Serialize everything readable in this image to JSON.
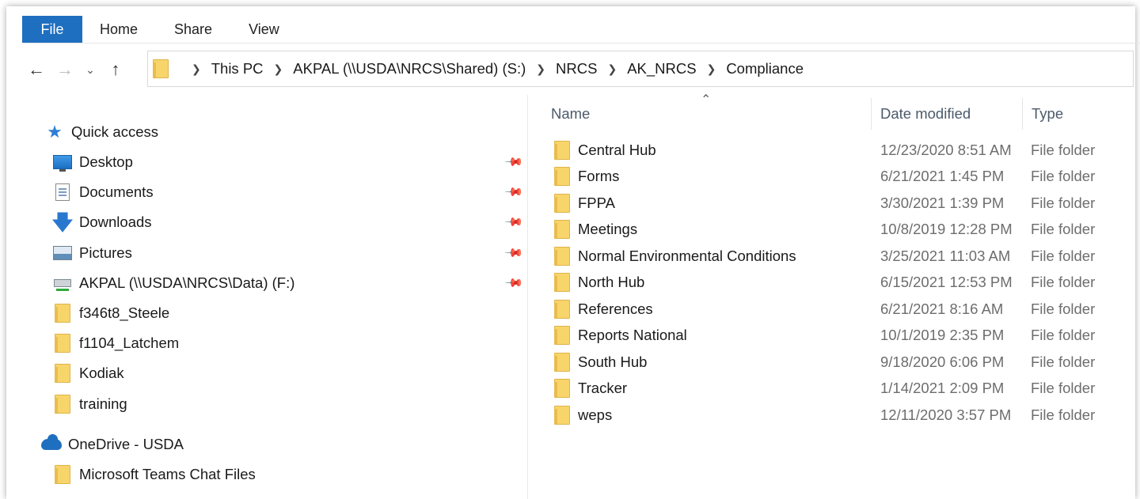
{
  "ribbon": {
    "tabs": [
      "File",
      "Home",
      "Share",
      "View"
    ]
  },
  "nav": {
    "back_icon": "arrow-left-icon",
    "forward_icon": "arrow-right-icon",
    "recent_icon": "chevron-down-icon",
    "up_icon": "arrow-up-icon"
  },
  "address": {
    "crumbs": [
      "This PC",
      "AKPAL (\\\\USDA\\NRCS\\Shared) (S:)",
      "NRCS",
      "AK_NRCS",
      "Compliance"
    ]
  },
  "sidebar": {
    "quick_access": "Quick access",
    "items": [
      {
        "label": "Desktop",
        "icon": "desktop-icon",
        "pinned": true
      },
      {
        "label": "Documents",
        "icon": "documents-icon",
        "pinned": true
      },
      {
        "label": "Downloads",
        "icon": "downloads-icon",
        "pinned": true
      },
      {
        "label": "Pictures",
        "icon": "pictures-icon",
        "pinned": true
      },
      {
        "label": "AKPAL (\\\\USDA\\NRCS\\Data) (F:)",
        "icon": "network-drive-icon",
        "pinned": true
      },
      {
        "label": "f346t8_Steele",
        "icon": "folder-icon",
        "pinned": false
      },
      {
        "label": "f1104_Latchem",
        "icon": "folder-icon",
        "pinned": false
      },
      {
        "label": "Kodiak",
        "icon": "folder-icon",
        "pinned": false
      },
      {
        "label": "training",
        "icon": "folder-icon",
        "pinned": false
      }
    ],
    "onedrive": "OneDrive - USDA",
    "onedrive_items": [
      {
        "label": "Microsoft Teams Chat Files",
        "icon": "folder-icon"
      }
    ]
  },
  "columns": {
    "name": "Name",
    "date": "Date modified",
    "type": "Type"
  },
  "files": [
    {
      "name": "Central Hub",
      "date": "12/23/2020 8:51 AM",
      "type": "File folder"
    },
    {
      "name": "Forms",
      "date": "6/21/2021 1:45 PM",
      "type": "File folder"
    },
    {
      "name": "FPPA",
      "date": "3/30/2021 1:39 PM",
      "type": "File folder"
    },
    {
      "name": "Meetings",
      "date": "10/8/2019 12:28 PM",
      "type": "File folder"
    },
    {
      "name": "Normal Environmental Conditions",
      "date": "3/25/2021 11:03 AM",
      "type": "File folder"
    },
    {
      "name": "North Hub",
      "date": "6/15/2021 12:53 PM",
      "type": "File folder"
    },
    {
      "name": "References",
      "date": "6/21/2021 8:16 AM",
      "type": "File folder"
    },
    {
      "name": "Reports National",
      "date": "10/1/2019 2:35 PM",
      "type": "File folder"
    },
    {
      "name": "South Hub",
      "date": "9/18/2020 6:06 PM",
      "type": "File folder"
    },
    {
      "name": "Tracker",
      "date": "1/14/2021 2:09 PM",
      "type": "File folder"
    },
    {
      "name": "weps",
      "date": "12/11/2020 3:57 PM",
      "type": "File folder"
    }
  ],
  "colors": {
    "file_tab": "#1f6fc0",
    "folder": "#f8d56b",
    "header_text": "#4b5a6a",
    "secondary_text": "#6d6d6d"
  }
}
